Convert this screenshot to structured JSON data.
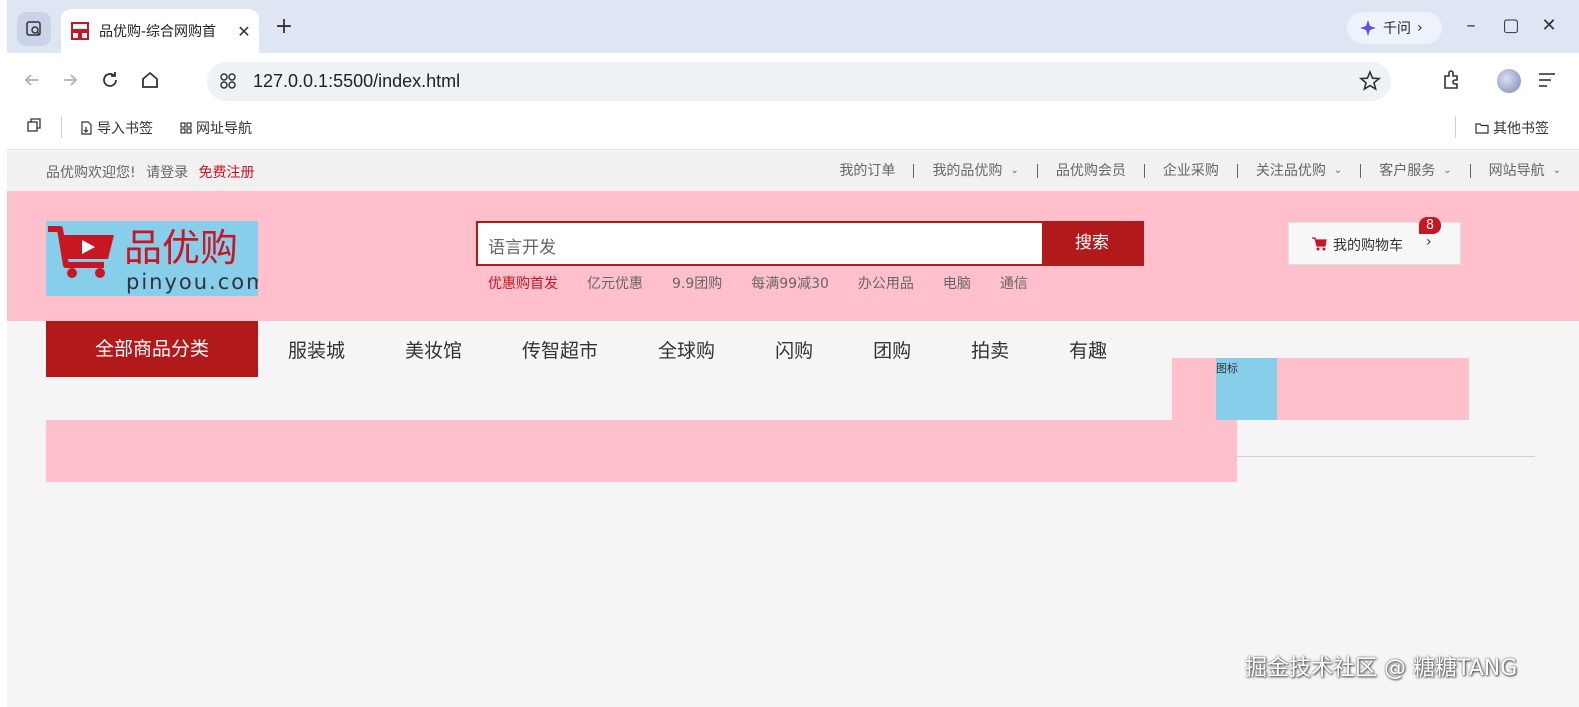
{
  "browser": {
    "tab_title": "品优购-综合网购首",
    "qianwen_label": "千问",
    "url": "127.0.0.1:5500/index.html",
    "bookmarks": {
      "import_label": "导入书签",
      "nav_label": "网址导航",
      "other_label": "其他书签"
    }
  },
  "shortcut": {
    "welcome": "品优购欢迎您!",
    "login": "请登录",
    "register": "免费注册",
    "items": [
      {
        "label": "我的订单",
        "dropdown": false
      },
      {
        "label": "我的品优购",
        "dropdown": true
      },
      {
        "label": "品优购会员",
        "dropdown": false
      },
      {
        "label": "企业采购",
        "dropdown": false
      },
      {
        "label": "关注品优购",
        "dropdown": true
      },
      {
        "label": "客户服务",
        "dropdown": true
      },
      {
        "label": "网站导航",
        "dropdown": true
      }
    ]
  },
  "header": {
    "logo_text": "品优购",
    "logo_domain": "pinyou.com",
    "search_placeholder": "语言开发",
    "search_button": "搜索",
    "hotwords": [
      "优惠购首发",
      "亿元优惠",
      "9.9团购",
      "每满99减30",
      "办公用品",
      "电脑",
      "通信"
    ],
    "cart_label": "我的购物车",
    "cart_count": "8"
  },
  "nav": {
    "all_categories": "全部商品分类",
    "items": [
      "服装城",
      "美妆馆",
      "传智超市",
      "全球购",
      "闪购",
      "团购",
      "拍卖",
      "有趣"
    ]
  },
  "icon_box_label": "图标",
  "watermark": "掘金技术社区 @ 糖糖TANG",
  "colors": {
    "brand_red": "#b1191a",
    "header_pink": "#ffc0cb",
    "logo_blue": "#87ceeb"
  }
}
